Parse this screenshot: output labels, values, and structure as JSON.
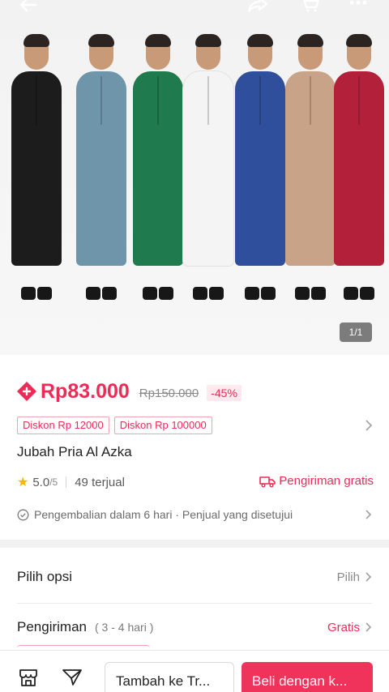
{
  "colors": {
    "accent": "#ee2a57",
    "buy_button": "#f0335a",
    "star": "#f7b500",
    "robes": [
      "#1c1c1c",
      "#6f95aa",
      "#1f7a4e",
      "#f4f4f4",
      "#2f4f9d",
      "#c9a387",
      "#b3203a"
    ]
  },
  "top_icons": [
    "back-arrow-icon",
    "share-icon",
    "cart-icon",
    "more-icon"
  ],
  "image": {
    "pager": "1/1"
  },
  "price": {
    "current": "Rp83.000",
    "original": "Rp150.000",
    "discount": "-45%"
  },
  "vouchers": [
    "Diskon Rp 12000",
    "Diskon Rp 100000"
  ],
  "product": {
    "title": "Jubah Pria Al Azka",
    "rating": "5.0",
    "rating_max": "/5",
    "sold": "49 terjual",
    "free_shipping": "Pengiriman gratis",
    "return_policy": "Pengembalian dalam 6 hari · Penjual yang disetujui"
  },
  "options": {
    "label": "Pilih opsi",
    "value": "Pilih"
  },
  "shipping": {
    "label": "Pengiriman",
    "duration": "( 3 - 4 hari )",
    "value": "Gratis"
  },
  "bottom_bar": {
    "add_to_cart": "Tambah ke Tr...",
    "buy": "Beli dengan k..."
  }
}
